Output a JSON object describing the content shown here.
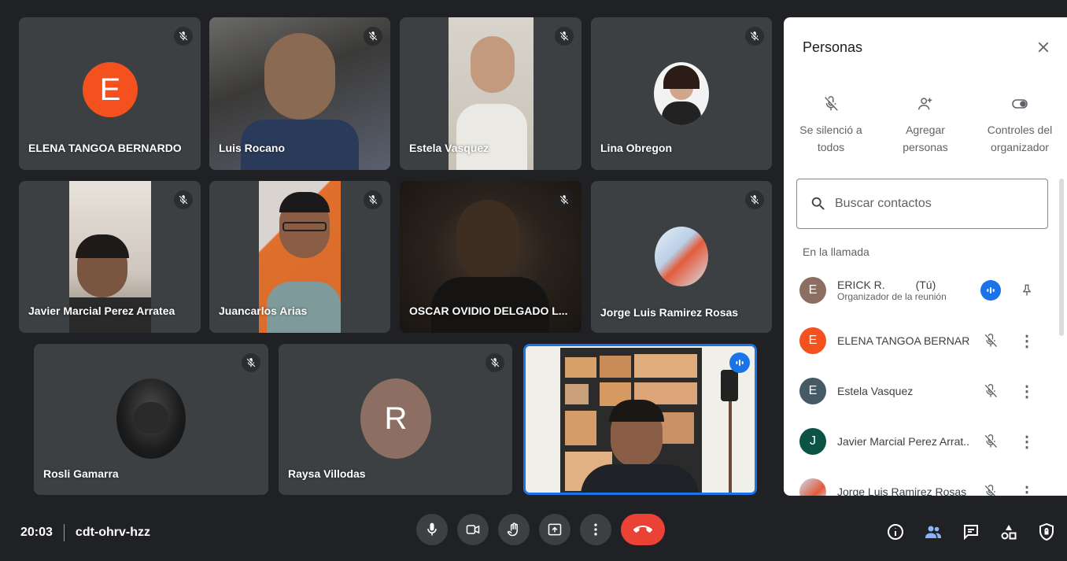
{
  "tiles": [
    {
      "name": "ELENA TANGOA BERNARDO",
      "avatar_letter": "E",
      "avatar_color": "#f4511e"
    },
    {
      "name": "Luis Rocano"
    },
    {
      "name": "Estela Vasquez"
    },
    {
      "name": "Lina Obregon"
    },
    {
      "name": "Javier Marcial Perez Arratea"
    },
    {
      "name": "Juancarlos Arias"
    },
    {
      "name": "OSCAR OVIDIO DELGADO L..."
    },
    {
      "name": "Jorge Luis Ramirez Rosas"
    },
    {
      "name": "Rosli Gamarra"
    },
    {
      "name": "Raysa Villodas",
      "avatar_letter": "R",
      "avatar_color": "#8d6e63"
    },
    {
      "name": ""
    }
  ],
  "panel": {
    "title": "Personas",
    "actions": [
      {
        "label": "Se silenció a todos",
        "icon": "mic-off-icon"
      },
      {
        "label": "Agregar personas",
        "icon": "person-add-icon"
      },
      {
        "label": "Controles del organizador",
        "icon": "toggle-icon"
      }
    ],
    "search_placeholder": "Buscar contactos",
    "section_label": "En la llamada",
    "people": [
      {
        "name": "ERICK R.",
        "tag": "(Tú)",
        "sub": "Organizador de la reunión",
        "letter": "E",
        "color": "#8d6e63"
      },
      {
        "name": "ELENA TANGOA BERNAR...",
        "letter": "E",
        "color": "#f4511e"
      },
      {
        "name": "Estela Vasquez",
        "letter": "E",
        "color": "#455a64"
      },
      {
        "name": "Javier Marcial Perez Arrat...",
        "letter": "J",
        "color": "#0b5345"
      },
      {
        "name": "Jorge Luis Ramirez Rosas",
        "letter": ""
      }
    ]
  },
  "bottom": {
    "time": "20:03",
    "meeting_code": "cdt-ohrv-hzz"
  },
  "colors": {
    "accent": "#1a73e8",
    "end_call": "#ea4335",
    "tile": "#3c4043"
  }
}
